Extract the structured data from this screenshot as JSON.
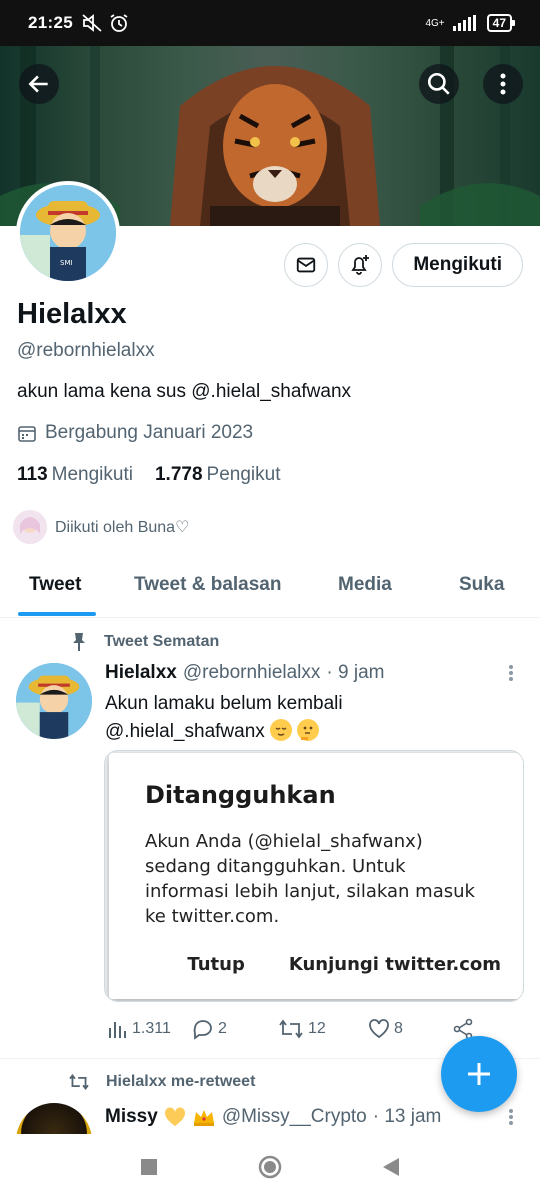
{
  "status_bar": {
    "time": "21:25",
    "network": "4G+",
    "battery": "47"
  },
  "profile": {
    "name": "Hielalxx",
    "handle": "@rebornhielalxx",
    "bio": "akun lama kena sus @.hielal_shafwanx",
    "joined": "Bergabung Januari 2023",
    "following_count": "113",
    "following_label": "Mengikuti",
    "followers_count": "1.778",
    "followers_label": "Pengikut",
    "followed_by": "Diikuti oleh Buna♡",
    "follow_button": "Mengikuti"
  },
  "tabs": [
    {
      "label": "Tweet",
      "active": true
    },
    {
      "label": "Tweet & balasan",
      "active": false
    },
    {
      "label": "Media",
      "active": false
    },
    {
      "label": "Suka",
      "active": false
    }
  ],
  "pinned_tweet": {
    "pinned_label": "Tweet Sematan",
    "author_name": "Hielalxx",
    "author_handle": "@rebornhielalxx",
    "time": "· 9 jam",
    "text_line1": "Akun lamaku belum kembali",
    "text_line2": "@.hielal_shafwanx",
    "dialog": {
      "title": "Ditangguhkan",
      "body": "Akun Anda (@hielal_shafwanx) sedang ditangguhkan. Untuk informasi lebih lanjut, silakan masuk ke twitter.com.",
      "button_close": "Tutup",
      "button_visit": "Kunjungi twitter.com"
    },
    "views": "1.311",
    "replies": "2",
    "retweets": "12",
    "likes": "8"
  },
  "second_tweet": {
    "retweet_label": "Hielalxx me-retweet",
    "author_name": "Missy",
    "author_handle": "@Missy__Crypto",
    "time": "· 13 jam"
  },
  "colors": {
    "accent": "#1d9bf0",
    "text": "#0f1419",
    "muted": "#536471"
  }
}
